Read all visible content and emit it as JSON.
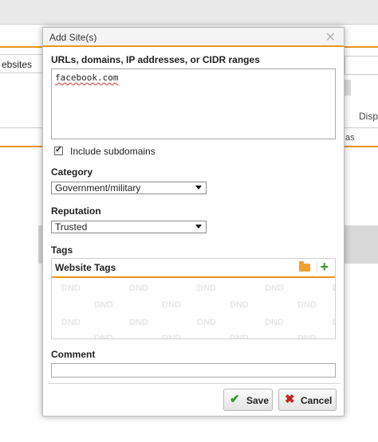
{
  "background": {
    "tab_label": "ebsites",
    "right_text": "Disp",
    "column_text": "as"
  },
  "dialog": {
    "title": "Add Site(s)",
    "close_icon": "close-icon",
    "urls_label": "URLs, domains, IP addresses, or CIDR ranges",
    "urls_value": "facebook.com",
    "include_subdomains_label": "Include subdomains",
    "include_subdomains_checked": true,
    "category_label": "Category",
    "category_value": "Government/military",
    "reputation_label": "Reputation",
    "reputation_value": "Trusted",
    "tags_label": "Tags",
    "tags_panel_title": "Website Tags",
    "tags_watermark": "DND",
    "comment_label": "Comment",
    "comment_value": "",
    "save_label": "Save",
    "cancel_label": "Cancel"
  },
  "colors": {
    "accent": "#e8961e",
    "save_check": "#2f9a2f",
    "cancel_x": "#c82020",
    "add_plus": "#3a9a2a"
  }
}
